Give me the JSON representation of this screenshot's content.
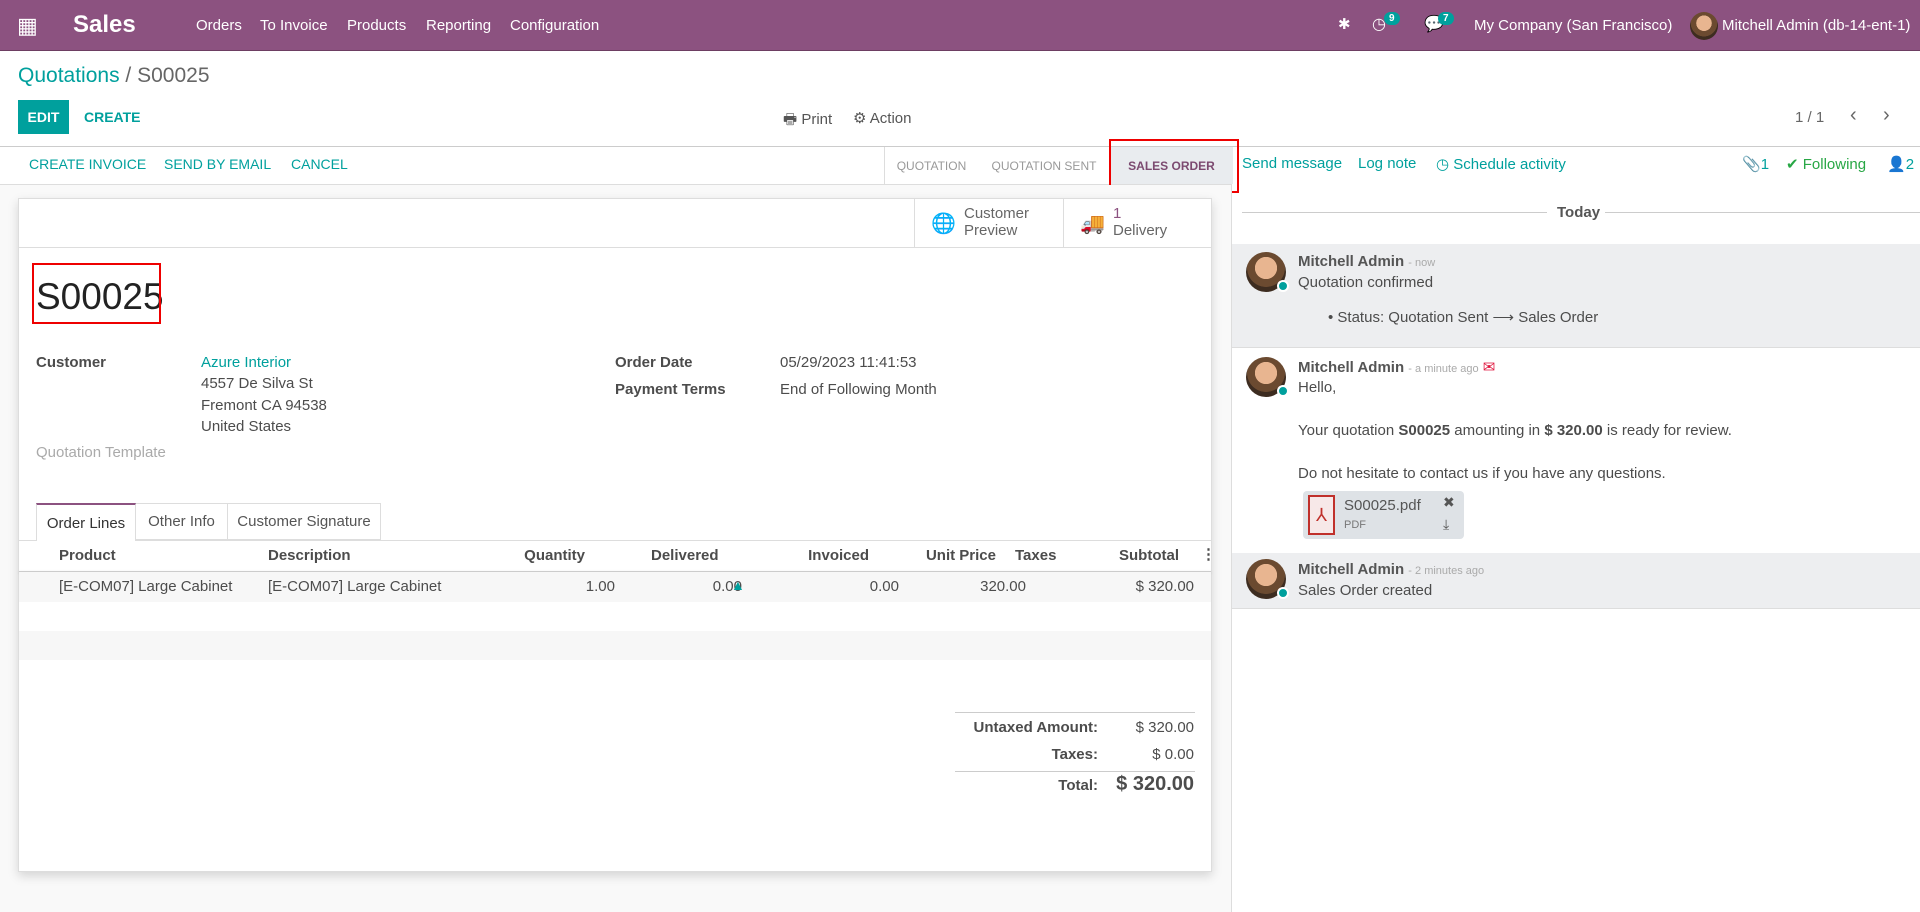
{
  "navbar": {
    "app": "Sales",
    "menu": [
      "Orders",
      "To Invoice",
      "Products",
      "Reporting",
      "Configuration"
    ],
    "activity_count": "9",
    "message_count": "7",
    "company": "My Company (San Francisco)",
    "user": "Mitchell Admin (db-14-ent-1)",
    "color": "#8c5280"
  },
  "breadcrumb": {
    "parent": "Quotations",
    "separator": "/",
    "current": "S00025"
  },
  "control": {
    "edit": "EDIT",
    "create": "CREATE",
    "print": "Print",
    "action": "Action",
    "pager": "1 / 1"
  },
  "header_buttons": [
    "CREATE INVOICE",
    "SEND BY EMAIL",
    "CANCEL"
  ],
  "stages": [
    {
      "label": "QUOTATION",
      "active": false
    },
    {
      "label": "QUOTATION SENT",
      "active": false
    },
    {
      "label": "SALES ORDER",
      "active": true
    }
  ],
  "chatter_top": {
    "send_message": "Send message",
    "log_note": "Log note",
    "schedule_activity": "Schedule activity",
    "attachments": "1",
    "following": "Following",
    "followers": "2"
  },
  "smart_buttons": {
    "preview_1": "Customer",
    "preview_2": "Preview",
    "delivery_count": "1",
    "delivery_label": "Delivery"
  },
  "form": {
    "name": "S00025",
    "customer_label": "Customer",
    "customer": "Azure Interior",
    "address": [
      "4557 De Silva St",
      "Fremont CA 94538",
      "United States"
    ],
    "template_label": "Quotation Template",
    "order_date_label": "Order Date",
    "order_date": "05/29/2023 11:41:53",
    "payment_terms_label": "Payment Terms",
    "payment_terms": "End of Following Month"
  },
  "tabs": [
    "Order Lines",
    "Other Info",
    "Customer Signature"
  ],
  "table": {
    "headers": [
      "Product",
      "Description",
      "Quantity",
      "Delivered",
      "Invoiced",
      "Unit Price",
      "Taxes",
      "Subtotal"
    ],
    "rows": [
      {
        "product": "[E-COM07] Large Cabinet",
        "description": "[E-COM07] Large Cabinet",
        "quantity": "1.00",
        "delivered": "0.00",
        "invoiced": "0.00",
        "unit_price": "320.00",
        "taxes": "",
        "subtotal": "$ 320.00"
      }
    ]
  },
  "totals": {
    "untaxed_label": "Untaxed Amount:",
    "untaxed": "$ 320.00",
    "taxes_label": "Taxes:",
    "taxes": "$ 0.00",
    "total_label": "Total:",
    "total": "$ 320.00"
  },
  "chatter": {
    "date_separator": "Today",
    "messages": [
      {
        "author": "Mitchell Admin",
        "date": "- now",
        "body": "Quotation confirmed",
        "tracking": "Status: Quotation Sent ⟶ Sales Order"
      },
      {
        "author": "Mitchell Admin",
        "date": "- a minute ago",
        "hello": "Hello,",
        "line_a": "Your quotation ",
        "ref": "S00025",
        "line_b": " amounting in ",
        "amount": "$ 320.00",
        "line_c": " is ready for review.",
        "line2": "Do not hesitate to contact us if you have any questions.",
        "attachment_name": "S00025.pdf",
        "attachment_type": "PDF"
      },
      {
        "author": "Mitchell Admin",
        "date": "- 2 minutes ago",
        "body": "Sales Order created"
      }
    ]
  }
}
